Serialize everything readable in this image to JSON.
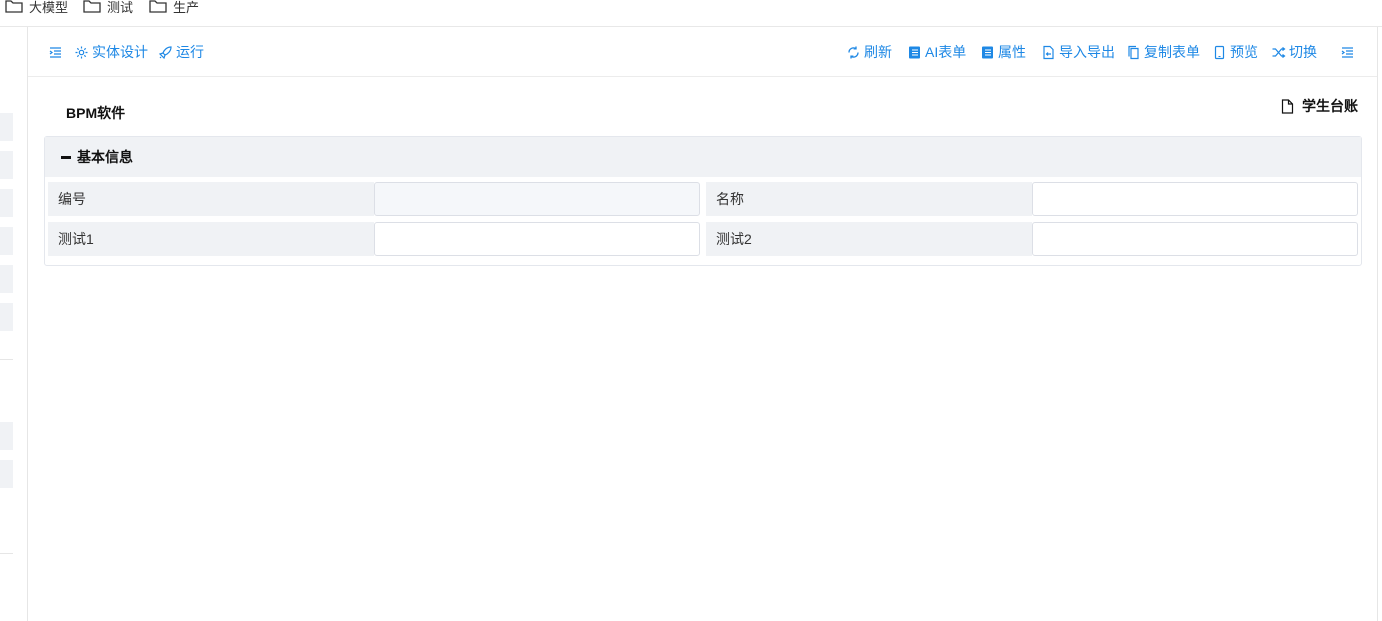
{
  "bookmarks": [
    {
      "label": "大模型",
      "icon": "folder-icon"
    },
    {
      "label": "测试",
      "icon": "folder-icon"
    },
    {
      "label": "生产",
      "icon": "folder-icon"
    }
  ],
  "toolbar": {
    "left": [
      {
        "label": "实体设计",
        "icon": "gear-icon"
      },
      {
        "label": "运行",
        "icon": "rocket-icon"
      }
    ],
    "right": [
      {
        "label": "刷新",
        "icon": "refresh-icon"
      },
      {
        "label": "AI表单",
        "icon": "document-icon"
      },
      {
        "label": "属性",
        "icon": "document-icon"
      },
      {
        "label": "导入导出",
        "icon": "import-export-icon"
      },
      {
        "label": "复制表单",
        "icon": "copy-icon"
      },
      {
        "label": "预览",
        "icon": "mobile-icon"
      },
      {
        "label": "切换",
        "icon": "shuffle-icon"
      }
    ]
  },
  "app_name": "BPM软件",
  "form_title": "学生台账",
  "section": {
    "title": "基本信息",
    "fields": [
      {
        "label": "编号",
        "value": "",
        "readonly": true
      },
      {
        "label": "名称",
        "value": "",
        "readonly": false
      },
      {
        "label": "测试1",
        "value": "",
        "readonly": false
      },
      {
        "label": "测试2",
        "value": "",
        "readonly": false
      }
    ]
  },
  "colors": {
    "accent": "#1e88e5",
    "label_bg": "#f0f2f5",
    "border": "#dcdfe6"
  }
}
